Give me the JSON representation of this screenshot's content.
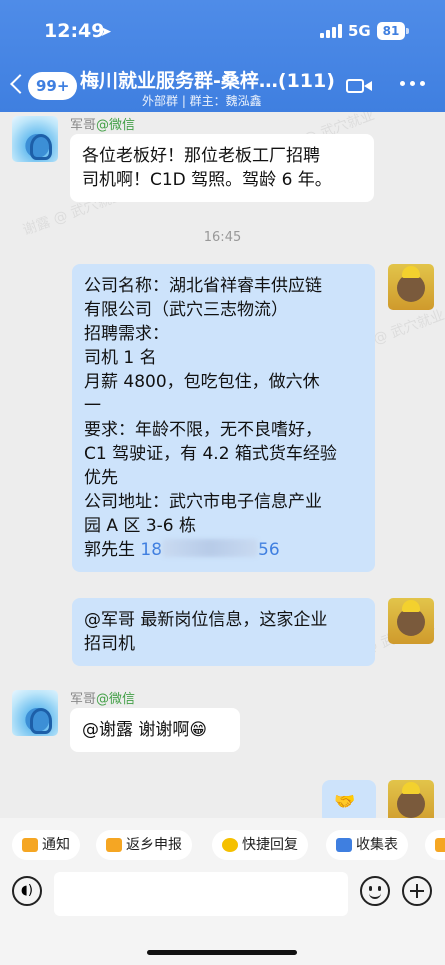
{
  "status_bar": {
    "time": "12:49",
    "network": "5G",
    "battery": "81"
  },
  "header": {
    "unread_count": "99+",
    "title": "梅川就业服务群-桑梓…(111)",
    "subtitle": "外部群 | 群主：魏泓鑫"
  },
  "watermark": "谢露 @ 武穴就业",
  "messages": [
    {
      "sender": "军哥",
      "via": "@微信",
      "lines": [
        "各位老板好！那位老板工厂招聘",
        "司机啊！C1D 驾照。驾龄 6 年。"
      ]
    },
    {
      "timestamp": "16:45"
    },
    {
      "lines": [
        "公司名称：湖北省祥睿丰供应链",
        "有限公司（武穴三志物流）",
        "招聘需求：",
        "司机 1 名",
        "月薪 4800，包吃包住，做六休",
        "一",
        "要求：年龄不限，无不良嗜好，",
        "C1 驾驶证，有 4.2 箱式货车经验",
        "优先",
        "公司地址：武穴市电子信息产业",
        "园 A 区 3-6 栋"
      ],
      "contact_prefix": "郭先生 ",
      "phone_visible": "18",
      "phone_tail": "56"
    },
    {
      "lines": [
        "@军哥 最新岗位信息，这家企业",
        "招司机"
      ]
    },
    {
      "sender": "军哥",
      "via": "@微信",
      "lines": [
        "@谢露 谢谢啊😁"
      ]
    },
    {
      "lines": [
        "🤝"
      ]
    }
  ],
  "toolbar": {
    "chips": [
      {
        "label": "通知",
        "color": "#f5a623"
      },
      {
        "label": "返乡申报",
        "color": "#f5a623"
      },
      {
        "label": "快捷回复",
        "color": "#f5c000"
      },
      {
        "label": "收集表",
        "color": "#3f7fe0"
      },
      {
        "label": "",
        "color": "#f5a623"
      }
    ]
  }
}
